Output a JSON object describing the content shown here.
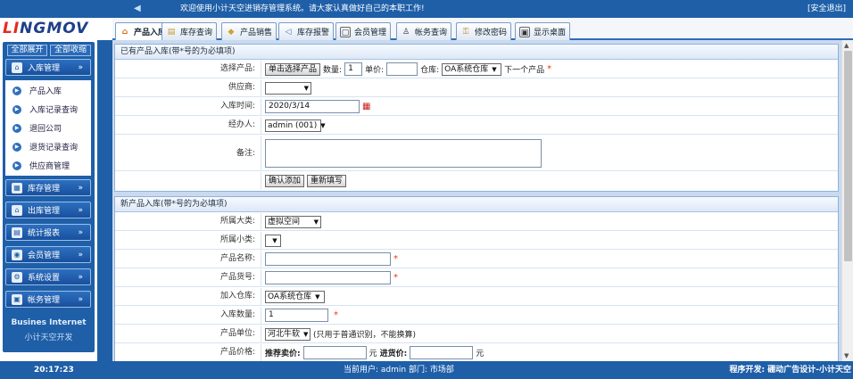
{
  "header": {
    "logo_main": "LINGMOV",
    "welcome": "欢迎使用小计天空进销存管理系统。请大家认真做好自己的本职工作!",
    "logout": "[安全退出]"
  },
  "tabs": [
    {
      "label": "产品入库",
      "icon": "house-icon",
      "active": true
    },
    {
      "label": "库存查询",
      "icon": "book-icon"
    },
    {
      "label": "产品销售",
      "icon": "tag-icon"
    },
    {
      "label": "库存报警",
      "icon": "speaker-icon"
    },
    {
      "label": "会员管理",
      "icon": "card-icon"
    },
    {
      "label": "帐务查询",
      "icon": "bag-icon"
    },
    {
      "label": "修改密码",
      "icon": "key-icon"
    },
    {
      "label": "显示桌面",
      "icon": "desktop-icon"
    }
  ],
  "sidebar": {
    "expand_all": "全部展开",
    "collapse_all": "全部收缩",
    "groups": [
      {
        "label": "入库管理",
        "icon": "inbound-icon",
        "items": [
          "产品入库",
          "入库记录查询",
          "退回公司",
          "退货记录查询",
          "供应商管理"
        ]
      },
      {
        "label": "库存管理",
        "icon": "inventory-icon"
      },
      {
        "label": "出库管理",
        "icon": "outbound-icon"
      },
      {
        "label": "统计报表",
        "icon": "report-icon"
      },
      {
        "label": "会员管理",
        "icon": "member-icon"
      },
      {
        "label": "系统设置",
        "icon": "settings-icon"
      },
      {
        "label": "帐务管理",
        "icon": "account-icon"
      }
    ],
    "brand_line1": "Busines Internet",
    "brand_line2": "小计天空开发"
  },
  "existing_form": {
    "title": "已有产品入库(带*号的为必填项)",
    "select_product_label": "选择产品:",
    "select_product_button": "单击选择产品",
    "qty_label": "数量:",
    "qty_value": "1",
    "price_label": "单价:",
    "price_value": "",
    "warehouse_label": "仓库:",
    "warehouse_value": "OA系统仓库",
    "next_product": "下一个产品",
    "supplier_label": "供应商:",
    "supplier_value": "",
    "date_label": "入库时间:",
    "date_value": "2020/3/14",
    "handler_label": "经办人:",
    "handler_value": "admin (001)",
    "note_label": "备注:",
    "note_value": "",
    "confirm_button": "确认添加",
    "reset_button": "重新填写"
  },
  "new_form": {
    "title": "新产品入库(带*号的为必填项)",
    "category_label": "所属大类:",
    "category_value": "虚拟空间",
    "subcategory_label": "所属小类:",
    "subcategory_value": "",
    "name_label": "产品名称:",
    "name_value": "",
    "code_label": "产品货号:",
    "code_value": "",
    "warehouse_label": "加入仓库:",
    "warehouse_value": "OA系统仓库",
    "qty_label": "入库数量:",
    "qty_value": "1",
    "unit_label": "产品单位:",
    "unit_value": "河北牛软",
    "unit_note": "(只用于普通识别，不能换算)",
    "price_label": "产品价格:",
    "sale_price_label": "推荐卖价:",
    "sale_price_value": "",
    "yuan1": "元",
    "buy_price_label": "进货价:",
    "buy_price_value": "",
    "yuan2": "元"
  },
  "footer": {
    "time": "20:17:23",
    "user": "当前用户: admin    部门: 市场部",
    "developer": "程序开发: 硼动广告设计-小计天空"
  },
  "required_mark": "*",
  "colors": {
    "primary": "#1e5fa8",
    "content_bg": "#c9daf0",
    "required": "#e31111"
  }
}
